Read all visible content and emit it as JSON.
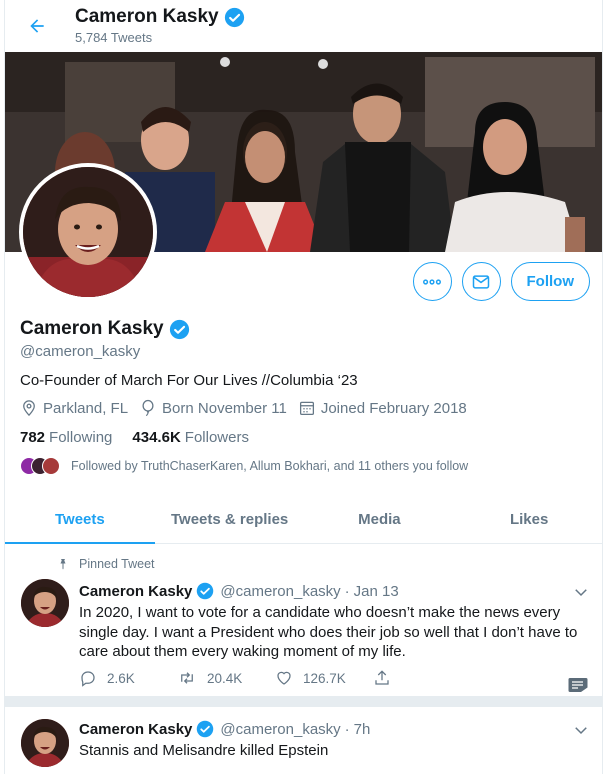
{
  "header": {
    "name": "Cameron Kasky",
    "tweet_count": "5,784 Tweets"
  },
  "profile": {
    "name": "Cameron Kasky",
    "handle": "@cameron_kasky",
    "bio": "Co-Founder of March For Our Lives //Columbia ‘23",
    "location": "Parkland, FL",
    "birthday": "Born November 11",
    "joined": "Joined February 2018",
    "following_count": "782",
    "following_label": "Following",
    "followers_count": "434.6K",
    "followers_label": "Followers",
    "followed_by": "Followed by TruthChaserKaren, Allum Bokhari, and 11 others you follow"
  },
  "actions": {
    "follow_label": "Follow"
  },
  "tabs": [
    {
      "label": "Tweets",
      "active": true
    },
    {
      "label": "Tweets & replies"
    },
    {
      "label": "Media"
    },
    {
      "label": "Likes"
    }
  ],
  "tweets": [
    {
      "pinned_label": "Pinned Tweet",
      "name": "Cameron Kasky",
      "handle": "@cameron_kasky",
      "date": "Jan 13",
      "text": "In 2020, I want to vote for a candidate who doesn’t make the news every single day. I want a President who does their job so well that I don’t have to care about them every waking moment of my life.",
      "replies": "2.6K",
      "retweets": "20.4K",
      "likes": "126.7K"
    },
    {
      "name": "Cameron Kasky",
      "handle": "@cameron_kasky",
      "date": "7h",
      "text": "Stannis and Melisandre killed Epstein"
    }
  ],
  "colors": {
    "accent": "#1da1f2",
    "muted": "#657786",
    "verified": "#1da1f2"
  }
}
